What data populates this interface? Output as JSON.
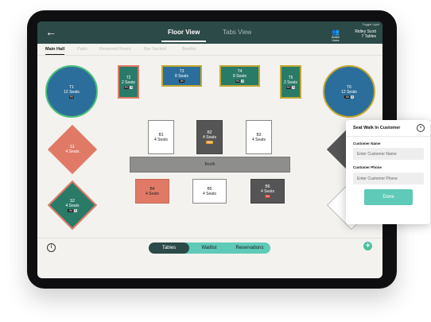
{
  "topbar": {
    "back_icon": "arrow-left-icon",
    "tab_floor": "Floor View",
    "tab_tabs": "Tabs View",
    "toggle_light": "Toggle Light",
    "switch_users": "Switch Users",
    "switch_users_icon": "users-icon",
    "user_name": "Ridley Scott",
    "user_tables": "7 Tables"
  },
  "sections": [
    "Main Hall",
    "Patio",
    "Reserved Room",
    "Bar Section",
    "Booths"
  ],
  "tables": {
    "T1": {
      "name": "T1",
      "seats": "12 Seats",
      "badges": [
        "RS"
      ]
    },
    "T2": {
      "name": "T2",
      "seats": "2 Seats",
      "badges": [
        "RS",
        "5"
      ]
    },
    "T3": {
      "name": "T3",
      "seats": "8 Seats",
      "badges": [
        "JM"
      ]
    },
    "T4": {
      "name": "T4",
      "seats": "8 Seats",
      "badges": [
        "RS",
        "5"
      ]
    },
    "T5": {
      "name": "T5",
      "seats": "2 Seats",
      "badges": [
        "RS",
        "5"
      ]
    },
    "T6": {
      "name": "T6",
      "seats": "12 Seats",
      "badges": [
        "JM",
        "5"
      ]
    },
    "S1": {
      "name": "S1",
      "seats": "4 Seats"
    },
    "S2": {
      "name": "S2",
      "seats": "4 Seats",
      "badges": [
        "JM",
        "5"
      ]
    },
    "B1": {
      "name": "B1",
      "seats": "4 Seats"
    },
    "B2": {
      "name": "B2",
      "seats": "4 Seats",
      "badges": [
        "15m"
      ]
    },
    "B3": {
      "name": "B3",
      "seats": "4 Seats"
    },
    "B4": {
      "name": "B4",
      "seats": "4 Seats"
    },
    "B5": {
      "name": "B5",
      "seats": "4 Seats"
    },
    "B6": {
      "name": "B6",
      "seats": "4 Seats",
      "badges": [
        "3m"
      ]
    },
    "booth": "Booth"
  },
  "bottombar": {
    "info_icon": "info-icon",
    "tab_tables": "Tables",
    "tab_waitlist": "Waitlist",
    "tab_reservations": "Reservations",
    "add_icon": "plus-icon"
  },
  "popup": {
    "title": "Seat Walk In Customer",
    "close_icon": "close-icon",
    "name_label": "Customer Name",
    "name_placeholder": "Enter Customer Name",
    "phone_label": "Customer Phone",
    "phone_placeholder": "Enter Customer Phone",
    "done_label": "Done"
  },
  "colors": {
    "header": "#2c4a47",
    "accent": "#5fcab8",
    "table_blue": "#2c6e9b",
    "table_green": "#2a7a68",
    "table_salmon": "#e07a66",
    "table_gray": "#555555",
    "table_border_gold": "#c2a833",
    "table_border_green": "#4dbf7a"
  }
}
